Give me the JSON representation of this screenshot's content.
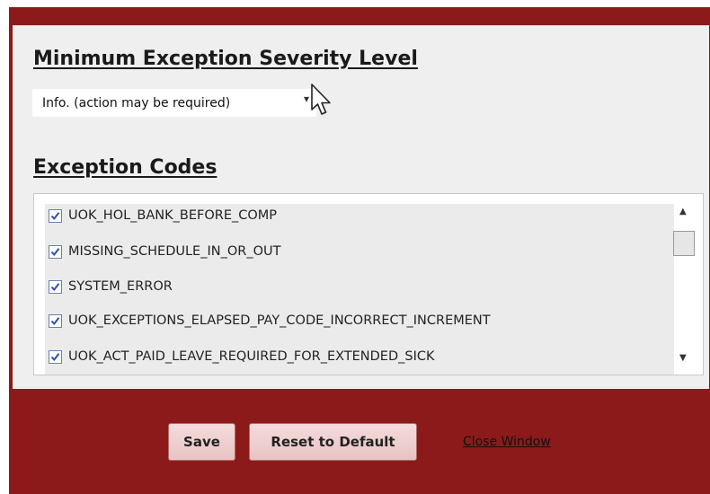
{
  "severity": {
    "heading": "Minimum Exception Severity Level",
    "selected_value": "Info. (action may be required)"
  },
  "codes": {
    "heading": "Exception Codes",
    "items": [
      {
        "label": "UOK_HOL_BANK_BEFORE_COMP",
        "checked": true
      },
      {
        "label": "MISSING_SCHEDULE_IN_OR_OUT",
        "checked": true
      },
      {
        "label": "SYSTEM_ERROR",
        "checked": true
      },
      {
        "label": "UOK_EXCEPTIONS_ELAPSED_PAY_CODE_INCORRECT_INCREMENT",
        "checked": true
      },
      {
        "label": "UOK_ACT_PAID_LEAVE_REQUIRED_FOR_EXTENDED_SICK",
        "checked": true
      }
    ]
  },
  "actions": {
    "save_label": "Save",
    "reset_label": "Reset to Default",
    "close_label": "Close Window"
  },
  "colors": {
    "frame_background": "#8c1a1a",
    "panel_background": "#efefef",
    "checkmark": "#2b4fa8",
    "button_background": "#f0d2d2"
  },
  "icons": {
    "select_arrow": "chevron-down-icon",
    "checkbox_check": "check-icon",
    "scroll_up": "arrow-up-icon",
    "scroll_down": "arrow-down-icon",
    "cursor": "mouse-pointer-icon"
  }
}
